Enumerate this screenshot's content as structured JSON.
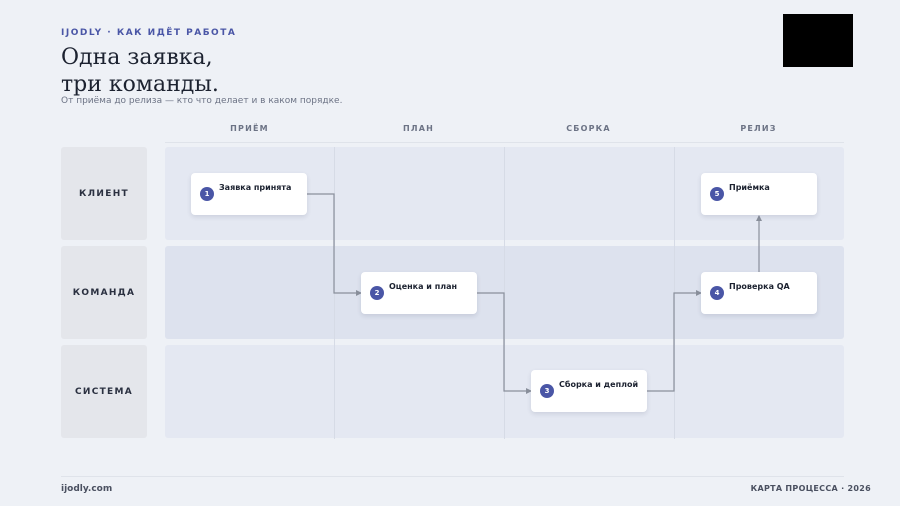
{
  "header": {
    "eyebrow": "IJODLY · КАК ИДЁТ РАБОТА",
    "title_line1": "Одна заявка,",
    "title_line2": "три команды.",
    "subtitle": "От приёма до релиза — кто что делает и в каком порядке."
  },
  "columns": [
    "ПРИЁМ",
    "ПЛАН",
    "СБОРКА",
    "РЕЛИЗ"
  ],
  "rows": [
    "КЛИЕНТ",
    "КОМАНДА",
    "СИСТЕМА"
  ],
  "steps": [
    {
      "number": "1",
      "label": "Заявка принята",
      "row": "КЛИЕНТ",
      "column": "ПРИЁМ"
    },
    {
      "number": "2",
      "label": "Оценка и план",
      "row": "КОМАНДА",
      "column": "ПЛАН"
    },
    {
      "number": "3",
      "label": "Сборка и деплой",
      "row": "СИСТЕМА",
      "column": "СБОРКА"
    },
    {
      "number": "4",
      "label": "Проверка QA",
      "row": "КОМАНДА",
      "column": "РЕЛИЗ"
    },
    {
      "number": "5",
      "label": "Приёмка",
      "row": "КЛИЕНТ",
      "column": "РЕЛИЗ"
    }
  ],
  "colors": {
    "accent": "#4a56a6",
    "background": "#eef1f6",
    "connector": "#8a909c"
  },
  "footer": {
    "left": "ijodly.com",
    "right": "КАРТА ПРОЦЕССА · 2026"
  }
}
